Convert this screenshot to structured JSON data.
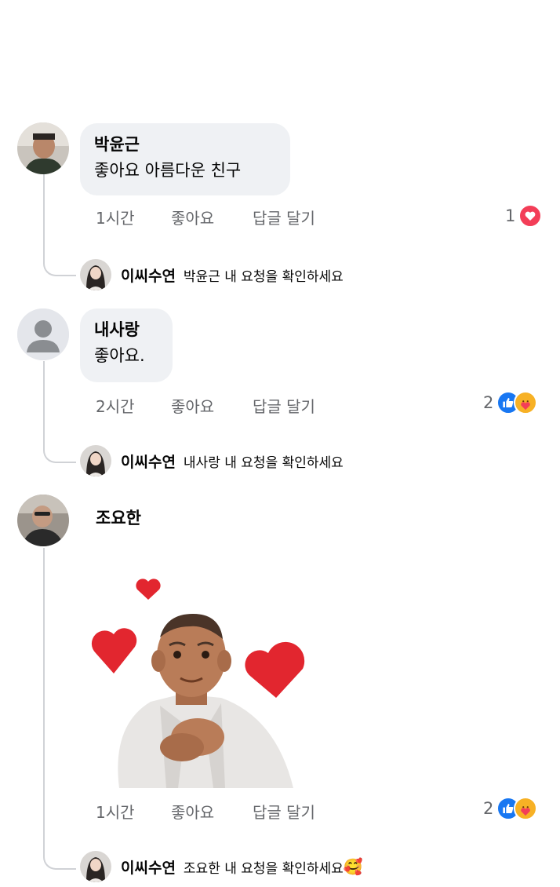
{
  "comments": [
    {
      "author": "박윤근",
      "text": "좋아요 아름다운 친구",
      "time": "1시간",
      "like_label": "좋아요",
      "reply_label": "답글 달기",
      "reaction_count": "1",
      "reactions": [
        "heart-icon"
      ],
      "reply": {
        "author": "이씨수연",
        "text": "박윤근 내 요청을 확인하세요"
      }
    },
    {
      "author": "내사랑",
      "text": "좋아요.",
      "time": "2시간",
      "like_label": "좋아요",
      "reply_label": "답글 달기",
      "reaction_count": "2",
      "reactions": [
        "like-icon",
        "care-icon"
      ],
      "reply": {
        "author": "이씨수연",
        "text": "내사랑 내 요청을 확인하세요"
      }
    },
    {
      "author": "조요한",
      "sticker": "avatar-sticker-with-hearts",
      "time": "1시간",
      "like_label": "좋아요",
      "reply_label": "답글 달기",
      "reaction_count": "2",
      "reactions": [
        "like-icon",
        "care-icon"
      ],
      "reply": {
        "author": "이씨수연",
        "text": "조요한 내 요청을 확인하세요",
        "emoji": "🥰"
      }
    }
  ],
  "colors": {
    "bubble": "#eff1f4",
    "meta_text": "#65676b",
    "like_blue": "#1877f2",
    "love_red": "#f33e58",
    "thread_line": "#d0d2d6"
  }
}
